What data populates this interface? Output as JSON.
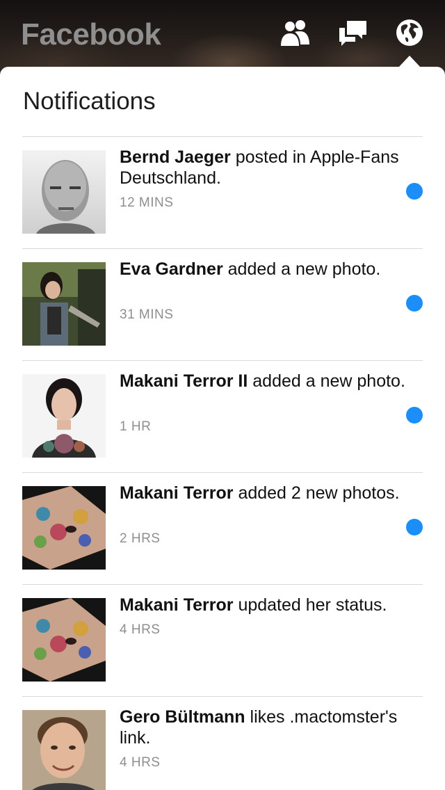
{
  "header": {
    "app_title": "Facebook",
    "icons": [
      "friend-requests-icon",
      "messages-icon",
      "notifications-globe-icon"
    ],
    "icon_color": "#ffffff"
  },
  "notifications": {
    "title": "Notifications",
    "unread_color": "#1c8ef9",
    "items": [
      {
        "name": "Bernd Jaeger",
        "action": "posted in Apple-Fans Deutschland.",
        "time": "12 MINS",
        "unread": true
      },
      {
        "name": "Eva Gardner",
        "action": "added a new photo.",
        "time": "31 MINS",
        "unread": true
      },
      {
        "name": "Makani Terror II",
        "action": "added a new photo.",
        "time": "1 HR",
        "unread": true
      },
      {
        "name": "Makani Terror",
        "action": "added 2 new photos.",
        "time": "2 HRS",
        "unread": true
      },
      {
        "name": "Makani Terror",
        "action": "updated her status.",
        "time": "4 HRS",
        "unread": false
      },
      {
        "name": "Gero Bültmann",
        "action": "likes .mactomster's link.",
        "time": "4 HRS",
        "unread": false
      }
    ]
  }
}
